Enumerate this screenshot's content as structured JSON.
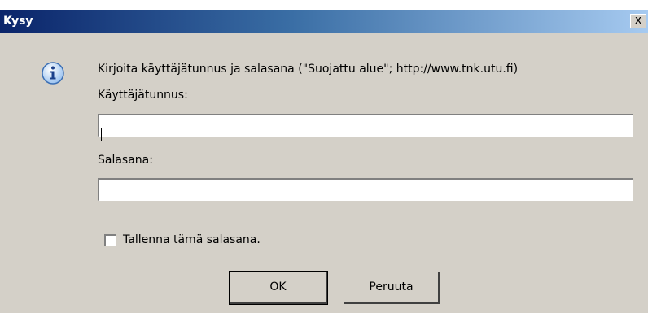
{
  "window": {
    "title": "Kysy",
    "close_glyph": "x"
  },
  "dialog": {
    "message": "Kirjoita käyttäjätunnus ja salasana (\"Suojattu alue\"; http://www.tnk.utu.fi)",
    "icon": "info-icon",
    "username_label": "Käyttäjätunnus:",
    "username_value": "",
    "password_label": "Salasana:",
    "password_value": "",
    "save_password_label": "Tallenna tämä salasana.",
    "save_password_checked": false,
    "ok_label": "OK",
    "cancel_label": "Peruuta"
  },
  "colors": {
    "dialog_bg": "#d4d0c8",
    "titlebar_start": "#0a246a",
    "titlebar_end": "#a6caf0",
    "info_icon": "#1a5fd6"
  }
}
